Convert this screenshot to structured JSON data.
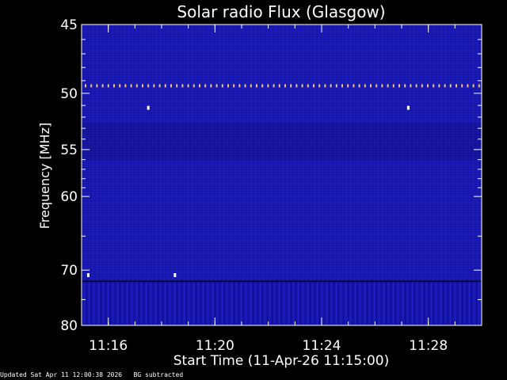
{
  "chart_data": {
    "type": "heatmap",
    "title": "Solar radio Flux (Glasgow)",
    "xlabel": "Start Time (11-Apr-26 11:15:00)",
    "ylabel": "Frequency [MHz]",
    "x_axis": {
      "start": "11:15:00",
      "end": "11:30:00",
      "ticks": [
        "11:16",
        "11:20",
        "11:24",
        "11:28"
      ],
      "minor_tick_interval_seconds": 60
    },
    "y_axis": {
      "scale": "reciprocal",
      "range": [
        45,
        80
      ],
      "ticks": [
        45,
        50,
        55,
        60,
        70,
        80
      ],
      "minor_ticks": [
        46,
        47,
        48,
        49,
        51,
        52,
        53,
        54,
        56,
        57,
        58,
        59,
        65,
        75
      ]
    },
    "grid": false,
    "colormap": "dark-blue to blue",
    "features": [
      {
        "kind": "interference-line",
        "frequency_mhz": 49.4,
        "color": "#f2c070"
      },
      {
        "kind": "interference-dot",
        "time": "11:17:30",
        "frequency_mhz": 51.2
      },
      {
        "kind": "interference-dot",
        "time": "11:27:15",
        "frequency_mhz": 51.2
      },
      {
        "kind": "interference-dot",
        "time": "11:15:15",
        "frequency_mhz": 70.8
      },
      {
        "kind": "interference-dot",
        "time": "11:18:30",
        "frequency_mhz": 70.8
      }
    ],
    "colors": {
      "background": "#000000",
      "plot_low": "#0b0a5e",
      "plot_high": "#2a2cff",
      "text": "#ffffff"
    }
  },
  "footer": {
    "updated": "Updated Sat Apr 11 12:00:38 2026",
    "note": "BG subtracted"
  }
}
